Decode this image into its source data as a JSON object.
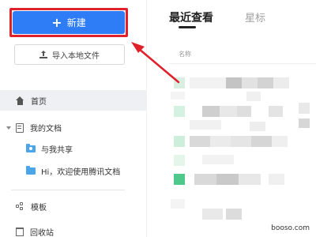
{
  "sidebar": {
    "new_button_label": "新建",
    "import_button_label": "导入本地文件",
    "home_label": "首页",
    "my_docs_label": "我的文档",
    "shared_label": "与我共享",
    "welcome_doc_label": "Hi，欢迎使用腾讯文档",
    "templates_label": "模板",
    "trash_label": "回收站"
  },
  "main": {
    "tabs": [
      {
        "label": "最近查看",
        "active": true
      },
      {
        "label": "星标",
        "active": false
      }
    ],
    "column_header": "名称"
  },
  "annotation": {
    "highlight_color": "#e0202a"
  },
  "colors": {
    "accent": "#2e7cf6",
    "folder": "#4aa6e8"
  },
  "icons": [
    "plus-icon",
    "upload-icon",
    "home-icon",
    "caret-down-icon",
    "document-icon",
    "shared-folder-icon",
    "folder-icon",
    "template-icon",
    "trash-icon"
  ],
  "watermark": "booso.com"
}
